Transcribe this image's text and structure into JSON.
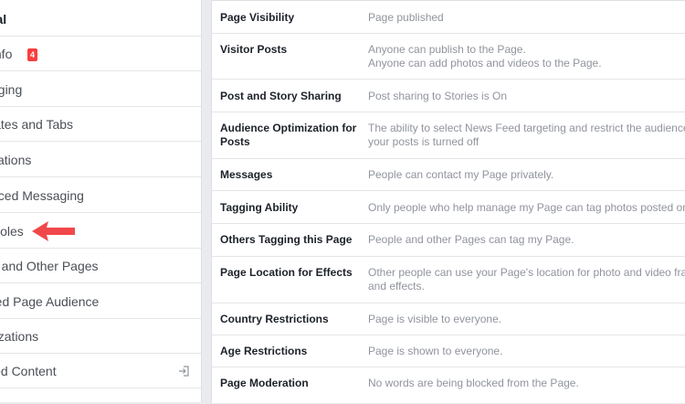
{
  "sidebar": {
    "items": [
      {
        "label": "ral",
        "active": true
      },
      {
        "label": "Info",
        "badge": "4"
      },
      {
        "label": "aging"
      },
      {
        "label": "lates and Tabs"
      },
      {
        "label": "cations"
      },
      {
        "label": "nced Messaging"
      },
      {
        "label": "Roles"
      },
      {
        "label": "e and Other Pages"
      },
      {
        "label": "red Page Audience"
      },
      {
        "label": "rizations"
      },
      {
        "label": "led Content",
        "icon": "exit-icon"
      }
    ]
  },
  "settings": [
    {
      "key": "Page Visibility",
      "value": [
        "Page published"
      ]
    },
    {
      "key": "Visitor Posts",
      "value": [
        "Anyone can publish to the Page.",
        "Anyone can add photos and videos to the Page."
      ]
    },
    {
      "key": "Post and Story Sharing",
      "value": [
        "Post sharing to Stories is On"
      ]
    },
    {
      "key": "Audience Optimization for Posts",
      "key_lines": [
        "Audience Optimization for",
        "Posts"
      ],
      "value": [
        "The ability to select News Feed targeting and restrict the audience fo",
        "your posts is turned off"
      ]
    },
    {
      "key": "Messages",
      "value": [
        "People can contact my Page privately."
      ]
    },
    {
      "key": "Tagging Ability",
      "value": [
        "Only people who help manage my Page can tag photos posted on it."
      ]
    },
    {
      "key": "Others Tagging this Page",
      "value": [
        "People and other Pages can tag my Page."
      ]
    },
    {
      "key": "Page Location for Effects",
      "value": [
        "Other people can use your Page's location for photo and video frame",
        "and effects."
      ]
    },
    {
      "key": "Country Restrictions",
      "value": [
        "Page is visible to everyone."
      ]
    },
    {
      "key": "Age Restrictions",
      "value": [
        "Page is shown to everyone."
      ]
    },
    {
      "key": "Page Moderation",
      "value": [
        "No words are being blocked from the Page."
      ]
    }
  ],
  "colors": {
    "accent_arrow": "#f0484a",
    "badge": "#fa3e3e"
  }
}
